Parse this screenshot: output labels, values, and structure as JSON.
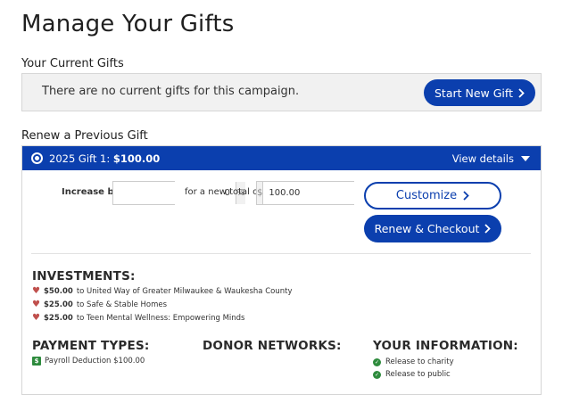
{
  "page": {
    "title": "Manage Your Gifts"
  },
  "current_gifts": {
    "title": "Your Current Gifts",
    "message": "There are no current gifts for this campaign.",
    "start_button": "Start New Gift"
  },
  "renew": {
    "title": "Renew a Previous Gift",
    "gift": {
      "name": "2025 Gift 1:",
      "amount": "$100.00",
      "view_details": "View details"
    },
    "increase_label": "Increase by",
    "increase_value": "0",
    "percent_symbol": "%",
    "total_label": "for a new total of",
    "currency_symbol": "$",
    "total_value": "100.00",
    "customize_button": "Customize",
    "renew_button": "Renew & Checkout"
  },
  "investments": {
    "heading": "INVESTMENTS:",
    "items": [
      {
        "amount": "$50.00",
        "text": "to United Way of Greater Milwaukee & Waukesha County"
      },
      {
        "amount": "$25.00",
        "text": "to Safe & Stable Homes"
      },
      {
        "amount": "$25.00",
        "text": "to Teen Mental Wellness: Empowering Minds"
      }
    ]
  },
  "payment_types": {
    "heading": "PAYMENT TYPES:",
    "badge": "$",
    "item": "Payroll Deduction $100.00"
  },
  "donor_networks": {
    "heading": "DONOR NETWORKS:"
  },
  "your_information": {
    "heading": "YOUR INFORMATION:",
    "items": [
      "Release to charity",
      "Release to public"
    ]
  },
  "colors": {
    "brand_blue": "#0b3fae",
    "heart_red": "#c0504d",
    "success_green": "#2e8b3d"
  }
}
